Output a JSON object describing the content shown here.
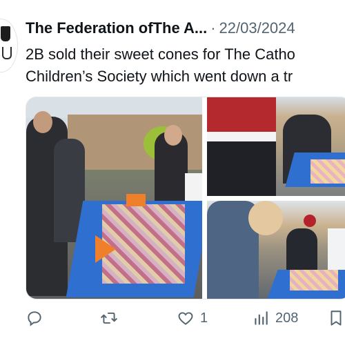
{
  "post": {
    "author": "The Federation ofThe A...",
    "separator": "·",
    "date": "22/03/2024",
    "text_line1": "2B sold their sweet cones for The Catho",
    "text_line2": "Children’s Society which went down a tr"
  },
  "media": {
    "photos": [
      {
        "name": "photo-sweet-cone-stall"
      },
      {
        "name": "photo-children-at-table"
      },
      {
        "name": "photo-children-choosing-sweets"
      }
    ]
  },
  "actions": {
    "reply_icon": "reply-icon",
    "retweet_icon": "retweet-icon",
    "like_icon": "heart-icon",
    "like_count": "1",
    "views_icon": "views-chart-icon",
    "views_count": "208",
    "bookmark_icon": "bookmark-icon"
  },
  "colors": {
    "text": "#0f1419",
    "muted": "#536471",
    "table_blue": "#2f6fd0"
  }
}
